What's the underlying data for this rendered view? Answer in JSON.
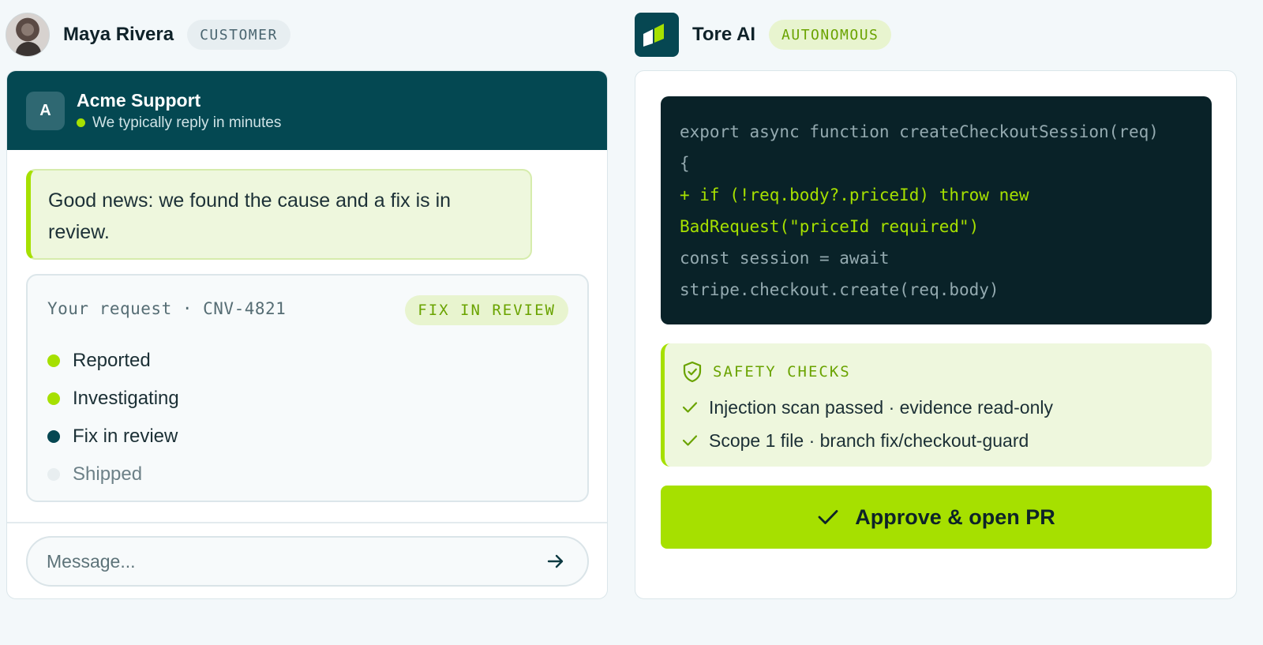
{
  "customer": {
    "name": "Maya Rivera",
    "role_badge": "CUSTOMER"
  },
  "agent": {
    "name": "Tore AI",
    "mode_badge": "AUTONOMOUS",
    "logo_icon": "tore-logo-icon"
  },
  "chat": {
    "header": {
      "avatar_letter": "A",
      "title": "Acme Support",
      "status": "We typically reply in minutes"
    },
    "message": "Good news: we found the cause and a fix is in review.",
    "request": {
      "label": "Your request · CNV-4821",
      "badge": "FIX IN REVIEW",
      "steps": [
        {
          "label": "Reported",
          "state": "done"
        },
        {
          "label": "Investigating",
          "state": "done"
        },
        {
          "label": "Fix in review",
          "state": "current"
        },
        {
          "label": "Shipped",
          "state": "pending"
        }
      ]
    },
    "input": {
      "placeholder": "Message...",
      "value": ""
    }
  },
  "code": {
    "lines": [
      {
        "text": "export async function createCheckoutSession(req)",
        "kind": "context"
      },
      {
        "text": "{",
        "kind": "context"
      },
      {
        "text": "+ if (!req.body?.priceId) throw new",
        "kind": "added"
      },
      {
        "text": "BadRequest(\"priceId required\")",
        "kind": "added"
      },
      {
        "text": "const session = await",
        "kind": "context"
      },
      {
        "text": "stripe.checkout.create(req.body)",
        "kind": "context"
      }
    ]
  },
  "safety": {
    "title": "SAFETY CHECKS",
    "checks": [
      "Injection scan passed · evidence read-only",
      "Scope 1 file · branch fix/checkout-guard"
    ]
  },
  "approve_button": {
    "label": "Approve & open PR"
  },
  "colors": {
    "accent_lime": "#a6e000",
    "brand_teal": "#044852",
    "code_bg": "#092228"
  }
}
